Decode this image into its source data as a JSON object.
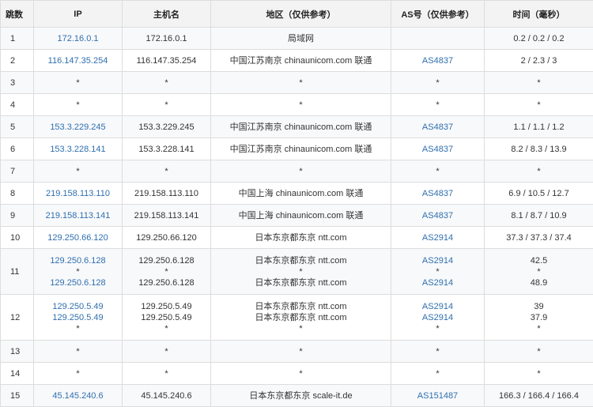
{
  "headers": {
    "hop": "跳数",
    "ip": "IP",
    "host": "主机名",
    "region": "地区（仅供参考）",
    "as": "AS号（仅供参考）",
    "time": "时间（毫秒）"
  },
  "rows": [
    {
      "hop": "1",
      "ip": [
        "172.16.0.1"
      ],
      "host": [
        "172.16.0.1"
      ],
      "region": [
        "局域网"
      ],
      "as": [
        ""
      ],
      "time": [
        "0.2 / 0.2 / 0.2"
      ]
    },
    {
      "hop": "2",
      "ip": [
        "116.147.35.254"
      ],
      "host": [
        "116.147.35.254"
      ],
      "region": [
        "中国江苏南京 chinaunicom.com 联通"
      ],
      "as": [
        "AS4837"
      ],
      "time": [
        "2 / 2.3 / 3"
      ]
    },
    {
      "hop": "3",
      "ip": [
        "*"
      ],
      "host": [
        "*"
      ],
      "region": [
        "*"
      ],
      "as": [
        "*"
      ],
      "time": [
        "*"
      ]
    },
    {
      "hop": "4",
      "ip": [
        "*"
      ],
      "host": [
        "*"
      ],
      "region": [
        "*"
      ],
      "as": [
        "*"
      ],
      "time": [
        "*"
      ]
    },
    {
      "hop": "5",
      "ip": [
        "153.3.229.245"
      ],
      "host": [
        "153.3.229.245"
      ],
      "region": [
        "中国江苏南京 chinaunicom.com 联通"
      ],
      "as": [
        "AS4837"
      ],
      "time": [
        "1.1 / 1.1 / 1.2"
      ]
    },
    {
      "hop": "6",
      "ip": [
        "153.3.228.141"
      ],
      "host": [
        "153.3.228.141"
      ],
      "region": [
        "中国江苏南京 chinaunicom.com 联通"
      ],
      "as": [
        "AS4837"
      ],
      "time": [
        "8.2 / 8.3 / 13.9"
      ]
    },
    {
      "hop": "7",
      "ip": [
        "*"
      ],
      "host": [
        "*"
      ],
      "region": [
        "*"
      ],
      "as": [
        "*"
      ],
      "time": [
        "*"
      ]
    },
    {
      "hop": "8",
      "ip": [
        "219.158.113.110"
      ],
      "host": [
        "219.158.113.110"
      ],
      "region": [
        "中国上海 chinaunicom.com 联通"
      ],
      "as": [
        "AS4837"
      ],
      "time": [
        "6.9 / 10.5 / 12.7"
      ]
    },
    {
      "hop": "9",
      "ip": [
        "219.158.113.141"
      ],
      "host": [
        "219.158.113.141"
      ],
      "region": [
        "中国上海 chinaunicom.com 联通"
      ],
      "as": [
        "AS4837"
      ],
      "time": [
        "8.1 / 8.7 / 10.9"
      ]
    },
    {
      "hop": "10",
      "ip": [
        "129.250.66.120"
      ],
      "host": [
        "129.250.66.120"
      ],
      "region": [
        "日本东京都东京 ntt.com"
      ],
      "as": [
        "AS2914"
      ],
      "time": [
        "37.3 / 37.3 / 37.4"
      ]
    },
    {
      "hop": "11",
      "ip": [
        "129.250.6.128",
        "*",
        "129.250.6.128"
      ],
      "host": [
        "129.250.6.128",
        "*",
        "129.250.6.128"
      ],
      "region": [
        "日本东京都东京 ntt.com",
        "*",
        "日本东京都东京 ntt.com"
      ],
      "as": [
        "AS2914",
        "*",
        "AS2914"
      ],
      "time": [
        "42.5",
        "*",
        "48.9"
      ]
    },
    {
      "hop": "12",
      "ip": [
        "129.250.5.49",
        "129.250.5.49",
        "*"
      ],
      "host": [
        "129.250.5.49",
        "129.250.5.49",
        "*"
      ],
      "region": [
        "日本东京都东京 ntt.com",
        "日本东京都东京 ntt.com",
        "*"
      ],
      "as": [
        "AS2914",
        "AS2914",
        "*"
      ],
      "time": [
        "39",
        "37.9",
        "*"
      ]
    },
    {
      "hop": "13",
      "ip": [
        "*"
      ],
      "host": [
        "*"
      ],
      "region": [
        "*"
      ],
      "as": [
        "*"
      ],
      "time": [
        "*"
      ]
    },
    {
      "hop": "14",
      "ip": [
        "*"
      ],
      "host": [
        "*"
      ],
      "region": [
        "*"
      ],
      "as": [
        "*"
      ],
      "time": [
        "*"
      ]
    },
    {
      "hop": "15",
      "ip": [
        "45.145.240.6"
      ],
      "host": [
        "45.145.240.6"
      ],
      "region": [
        "日本东京都东京 scale-it.de"
      ],
      "as": [
        "AS151487"
      ],
      "time": [
        "166.3 / 166.4 / 166.4"
      ]
    }
  ]
}
